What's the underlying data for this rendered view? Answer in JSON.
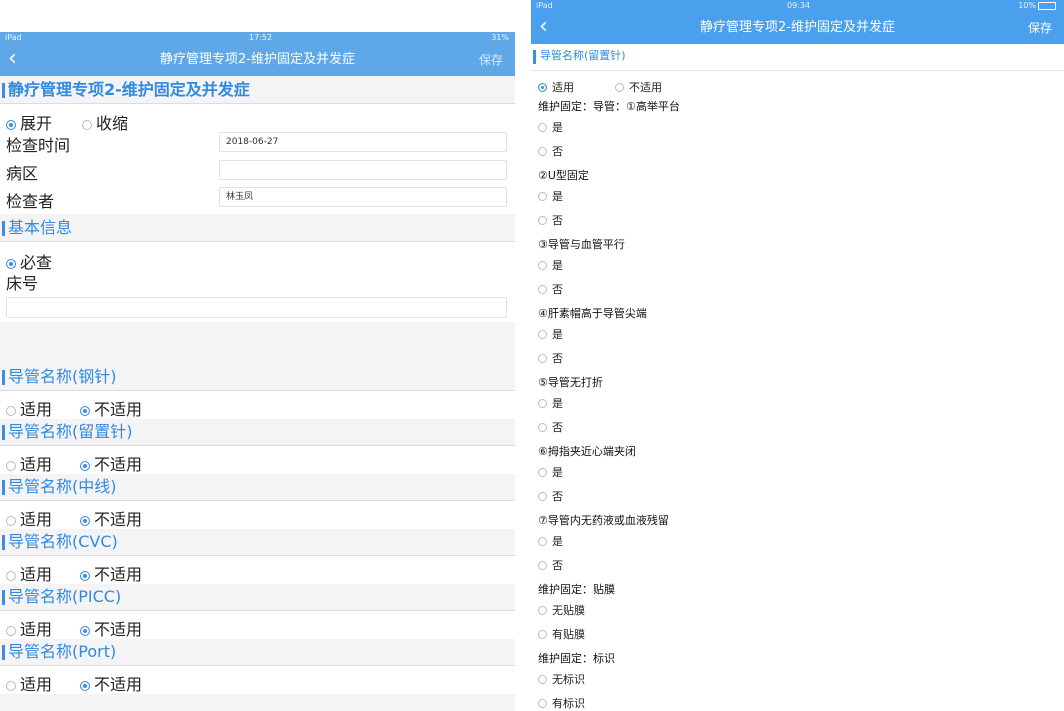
{
  "left": {
    "status": {
      "device": "iPad ",
      "time": "17:52",
      "battery": "31%"
    },
    "nav": {
      "back": "‹",
      "title": "静疗管理专项2-维护固定及并发症",
      "save": "保存"
    },
    "form_title": "静疗管理专项2-维护固定及并发症",
    "expand": "展开",
    "collapse": "收缩",
    "check_time_label": "检查时间",
    "check_time_value": "2018-06-27",
    "ward_label": "病区",
    "ward_value": "",
    "inspector_label": "检查者",
    "inspector_value": "林玉凤",
    "basic_info": "基本信息",
    "required": "必查",
    "bed_label": "床号",
    "bed_value": "",
    "catheters": [
      {
        "title": "导管名称(钢针)",
        "yes": "适用",
        "no": "不适用"
      },
      {
        "title": "导管名称(留置针)",
        "yes": "适用",
        "no": "不适用"
      },
      {
        "title": "导管名称(中线)",
        "yes": "适用",
        "no": "不适用"
      },
      {
        "title": "导管名称(CVC)",
        "yes": "适用",
        "no": "不适用"
      },
      {
        "title": "导管名称(PICC)",
        "yes": "适用",
        "no": "不适用"
      },
      {
        "title": "导管名称(Port)",
        "yes": "适用",
        "no": "不适用"
      }
    ]
  },
  "right": {
    "status": {
      "device": "iPad",
      "time": "09:34",
      "battery": "10%"
    },
    "nav": {
      "back": "‹",
      "title": "静疗管理专项2-维护固定及并发症",
      "save": "保存"
    },
    "section_title": "导管名称(留置针)",
    "applicable": "适用",
    "not_applicable": "不适用",
    "questions": [
      {
        "q": "维护固定：导管：①高举平台",
        "options": [
          "是",
          "否"
        ]
      },
      {
        "q": "②U型固定",
        "options": [
          "是",
          "否"
        ]
      },
      {
        "q": "③导管与血管平行",
        "options": [
          "是",
          "否"
        ]
      },
      {
        "q": "④肝素帽高于导管尖端",
        "options": [
          "是",
          "否"
        ]
      },
      {
        "q": "⑤导管无打折",
        "options": [
          "是",
          "否"
        ]
      },
      {
        "q": "⑥拇指夹近心端夹闭",
        "options": [
          "是",
          "否"
        ]
      },
      {
        "q": "⑦导管内无药液或血液残留",
        "options": [
          "是",
          "否"
        ]
      },
      {
        "q": "维护固定：贴膜",
        "options": [
          "无贴膜",
          "有贴膜"
        ]
      },
      {
        "q": "维护固定：标识",
        "options": [
          "无标识",
          "有标识"
        ]
      }
    ]
  }
}
